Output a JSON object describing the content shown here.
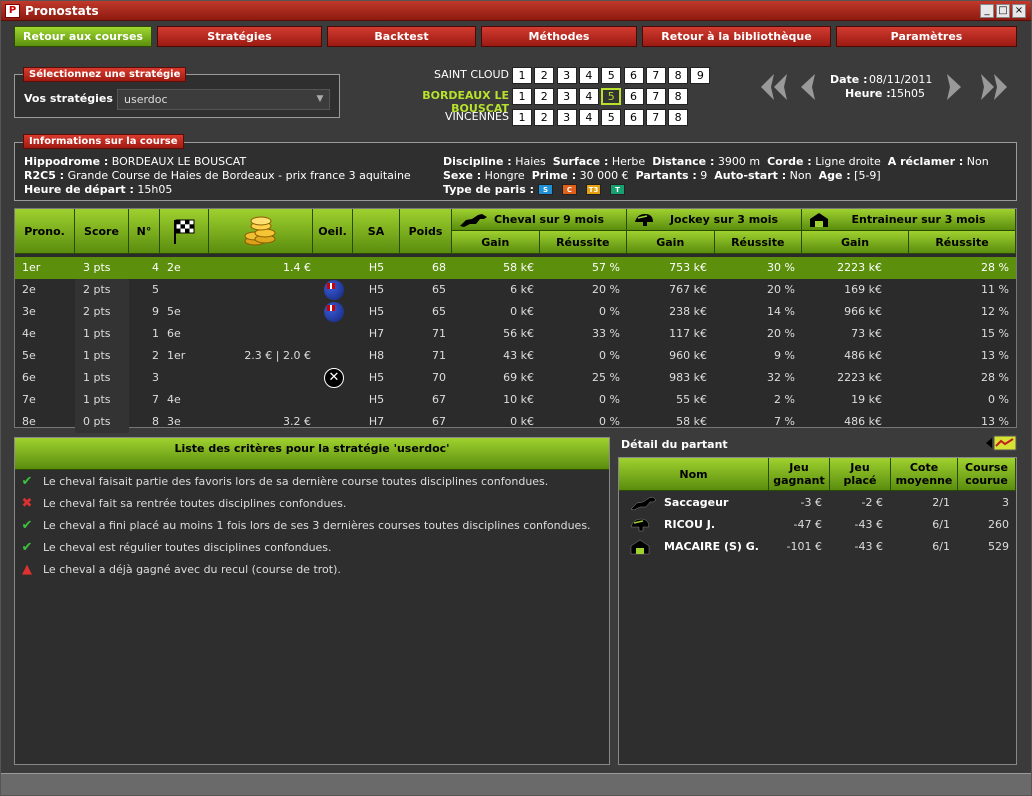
{
  "window": {
    "title": "Pronostats"
  },
  "nav": [
    "Retour aux courses",
    "Stratégies",
    "Backtest",
    "Méthodes",
    "Retour à la bibliothèque",
    "Paramètres"
  ],
  "strategy": {
    "section_title": "Sélectionnez une stratégie",
    "label": "Vos stratégies",
    "value": "userdoc"
  },
  "races": [
    {
      "name": "SAINT CLOUD",
      "numbers": [
        "1",
        "2",
        "3",
        "4",
        "5",
        "6",
        "7",
        "8",
        "9"
      ]
    },
    {
      "name": "BORDEAUX LE BOUSCAT",
      "numbers": [
        "1",
        "2",
        "3",
        "4",
        "5",
        "6",
        "7",
        "8"
      ],
      "selected": "5"
    },
    {
      "name": "VINCENNES",
      "numbers": [
        "1",
        "2",
        "3",
        "4",
        "5",
        "6",
        "7",
        "8"
      ]
    }
  ],
  "date": {
    "date_label": "Date :",
    "date": "08/11/2011",
    "time_label": "Heure :",
    "time": "15h05"
  },
  "info": {
    "section_title": "Informations sur la course",
    "hippodrome_label": "Hippodrome :",
    "hippodrome": "BORDEAUX LE BOUSCAT",
    "race_label": "R2C5 :",
    "race": "Grande Course de Haies de Bordeaux - prix france 3 aquitaine",
    "depart_label": "Heure de départ :",
    "depart": "15h05",
    "discipline_label": "Discipline :",
    "discipline": "Haies",
    "surface_label": "Surface :",
    "surface": "Herbe",
    "distance_label": "Distance :",
    "distance": "3900 m",
    "corde_label": "Corde :",
    "corde": "Ligne droite",
    "reclamer_label": "A réclamer :",
    "reclamer": "Non",
    "sexe_label": "Sexe :",
    "sexe": "Hongre",
    "prime_label": "Prime :",
    "prime": "30 000 €",
    "partants_label": "Partants :",
    "partants": "9",
    "autostart_label": "Auto-start :",
    "autostart": "Non",
    "age_label": "Age :",
    "age": "[5-9]",
    "paris_label": "Type de paris :",
    "paris": [
      {
        "t": "S",
        "c": "#1f8fd6"
      },
      {
        "t": "C",
        "c": "#e0601a"
      },
      {
        "t": "T3",
        "c": "#e5a010"
      },
      {
        "t": "T",
        "c": "#18a070"
      }
    ]
  },
  "table": {
    "headers": {
      "prono": "Prono.",
      "score": "Score",
      "num": "N°",
      "oeil": "Oeil.",
      "sa": "SA",
      "poids": "Poids",
      "cheval": "Cheval sur 9 mois",
      "jockey": "Jockey sur 3 mois",
      "entraineur": "Entraineur sur 3 mois",
      "gain": "Gain",
      "reussite": "Réussite"
    },
    "rows": [
      {
        "prono": "1er",
        "score": "3 pts",
        "num": "4",
        "last": "2e",
        "cote": "1.4 €",
        "oeil": "",
        "sa": "H5",
        "poids": "68",
        "cg": "58 k€",
        "cr": "57 %",
        "jg": "753 k€",
        "jr": "30 %",
        "eg": "2223 k€",
        "er": "28 %"
      },
      {
        "prono": "2e",
        "score": "2 pts",
        "num": "5",
        "last": "",
        "cote": "",
        "oeil": "flag",
        "sa": "H5",
        "poids": "65",
        "cg": "6 k€",
        "cr": "20 %",
        "jg": "767 k€",
        "jr": "20 %",
        "eg": "169 k€",
        "er": "11 %"
      },
      {
        "prono": "3e",
        "score": "2 pts",
        "num": "9",
        "last": "5e",
        "cote": "",
        "oeil": "flag",
        "sa": "H5",
        "poids": "65",
        "cg": "0 k€",
        "cr": "0 %",
        "jg": "238 k€",
        "jr": "14 %",
        "eg": "966 k€",
        "er": "12 %"
      },
      {
        "prono": "4e",
        "score": "1 pts",
        "num": "1",
        "last": "6e",
        "cote": "",
        "oeil": "",
        "sa": "H7",
        "poids": "71",
        "cg": "56 k€",
        "cr": "33 %",
        "jg": "117 k€",
        "jr": "20 %",
        "eg": "73 k€",
        "er": "15 %"
      },
      {
        "prono": "5e",
        "score": "1 pts",
        "num": "2",
        "last": "1er",
        "cote": "2.3 € | 2.0 €",
        "oeil": "",
        "sa": "H8",
        "poids": "71",
        "cg": "43 k€",
        "cr": "0 %",
        "jg": "960 k€",
        "jr": "9 %",
        "eg": "486 k€",
        "er": "13 %"
      },
      {
        "prono": "6e",
        "score": "1 pts",
        "num": "3",
        "last": "",
        "cote": "",
        "oeil": "x",
        "sa": "H5",
        "poids": "70",
        "cg": "69 k€",
        "cr": "25 %",
        "jg": "983 k€",
        "jr": "32 %",
        "eg": "2223 k€",
        "er": "28 %"
      },
      {
        "prono": "7e",
        "score": "1 pts",
        "num": "7",
        "last": "4e",
        "cote": "",
        "oeil": "",
        "sa": "H5",
        "poids": "67",
        "cg": "10 k€",
        "cr": "0 %",
        "jg": "55 k€",
        "jr": "2 %",
        "eg": "19 k€",
        "er": "0 %"
      },
      {
        "prono": "8e",
        "score": "0 pts",
        "num": "8",
        "last": "3e",
        "cote": "3.2 €",
        "oeil": "",
        "sa": "H7",
        "poids": "67",
        "cg": "0 k€",
        "cr": "0 %",
        "jg": "58 k€",
        "jr": "7 %",
        "eg": "486 k€",
        "er": "13 %"
      }
    ]
  },
  "criteria": {
    "title": "Liste des critères pour la stratégie 'userdoc'",
    "items": [
      {
        "status": "ok",
        "text": "Le cheval faisait partie des favoris lors de sa dernière course toutes disciplines confondues."
      },
      {
        "status": "ko",
        "text": "Le cheval fait sa rentrée toutes disciplines confondues."
      },
      {
        "status": "ok",
        "text": "Le cheval a fini placé au moins 1 fois lors de ses 3 dernières courses toutes disciplines confondues."
      },
      {
        "status": "ok",
        "text": "Le cheval est régulier toutes disciplines confondues."
      },
      {
        "status": "warn",
        "text": "Le cheval a déjà gagné avec du recul (course de trot)."
      }
    ]
  },
  "detail": {
    "title": "Détail du partant",
    "headers": {
      "nom": "Nom",
      "jg": "Jeu gagnant",
      "jp": "Jeu placé",
      "cote": "Cote moyenne",
      "course": "Course courue"
    },
    "rows": [
      {
        "icon": "horse",
        "nom": "Saccageur",
        "jg": "-3 €",
        "jp": "-2 €",
        "cote": "2/1",
        "course": "3"
      },
      {
        "icon": "jockey",
        "nom": "RICOU J.",
        "jg": "-47 €",
        "jp": "-43 €",
        "cote": "6/1",
        "course": "260"
      },
      {
        "icon": "trainer",
        "nom": "MACAIRE (S) G.",
        "jg": "-101 €",
        "jp": "-43 €",
        "cote": "6/1",
        "course": "529"
      }
    ]
  }
}
